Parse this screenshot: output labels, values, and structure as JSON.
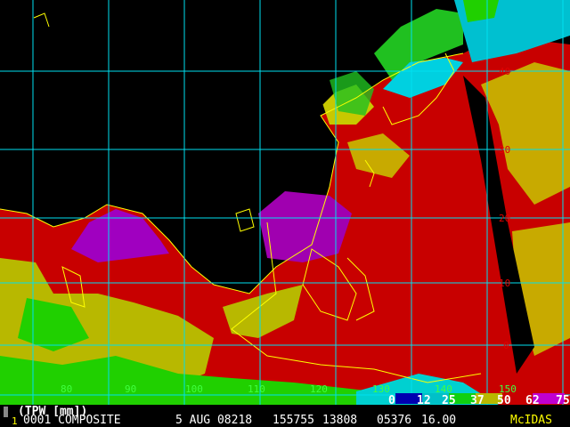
{
  "product_label": "(TPW [mm])",
  "status_line": {
    "frame": "1",
    "source": "0001 COMPOSITE",
    "date": "5 AUG 08218",
    "time": "155755",
    "line": "13808",
    "element": "05376",
    "resolution": "16.00",
    "brand": "McIDAS"
  },
  "latitude_labels": [
    "40",
    "30",
    "20",
    "10",
    "0"
  ],
  "longitude_labels": [
    "80",
    "90",
    "100",
    "110",
    "120",
    "130",
    "140",
    "150"
  ],
  "colorbar": {
    "labels": [
      "0",
      "12",
      "25",
      "37",
      "50",
      "62",
      "75"
    ],
    "colors": [
      "#0000b0",
      "#00c8d0",
      "#00d800",
      "#c8c800",
      "#d00000",
      "#d000d0"
    ]
  },
  "colors": {
    "grid": "#00e0f0",
    "coast": "#ffff00",
    "background": "#000000"
  }
}
